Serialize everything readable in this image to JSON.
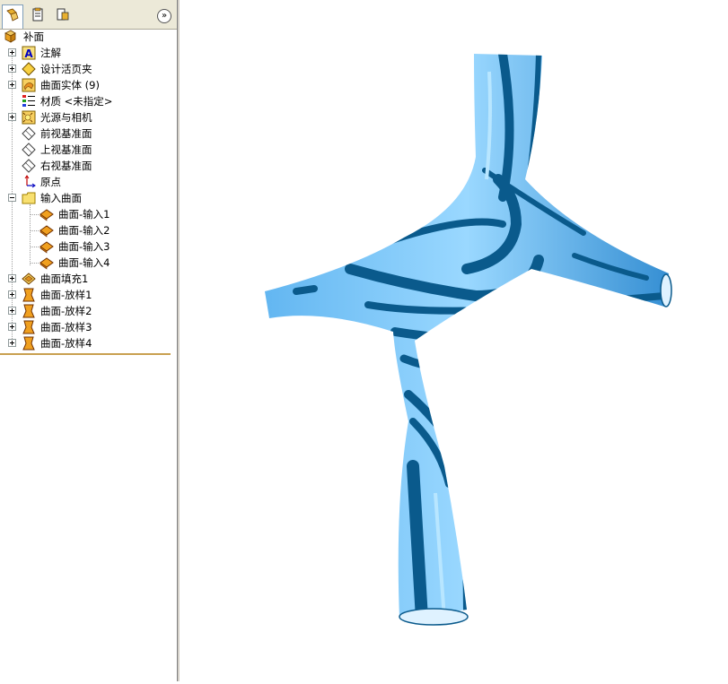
{
  "tree": {
    "root": "补面",
    "items": [
      {
        "label": "注解",
        "icon": "annotation-icon",
        "expander": "closed"
      },
      {
        "label": "设计活页夹",
        "icon": "design-binder-icon",
        "expander": "closed"
      },
      {
        "label": "曲面实体 (9)",
        "icon": "surface-bodies-icon",
        "expander": "closed"
      },
      {
        "label": "材质 <未指定>",
        "icon": "material-icon",
        "expander": "none"
      },
      {
        "label": "光源与相机",
        "icon": "lights-cameras-icon",
        "expander": "closed"
      },
      {
        "label": "前视基准面",
        "icon": "plane-icon",
        "expander": "none"
      },
      {
        "label": "上视基准面",
        "icon": "plane-icon",
        "expander": "none"
      },
      {
        "label": "右视基准面",
        "icon": "plane-icon",
        "expander": "none"
      },
      {
        "label": "原点",
        "icon": "origin-icon",
        "expander": "none"
      },
      {
        "label": "输入曲面",
        "icon": "folder-icon",
        "expander": "open"
      },
      {
        "label": "曲面-输入1",
        "icon": "imported-surface-icon",
        "expander": "child"
      },
      {
        "label": "曲面-输入2",
        "icon": "imported-surface-icon",
        "expander": "child"
      },
      {
        "label": "曲面-输入3",
        "icon": "imported-surface-icon",
        "expander": "child"
      },
      {
        "label": "曲面-输入4",
        "icon": "imported-surface-icon",
        "expander": "child"
      },
      {
        "label": "曲面填充1",
        "icon": "filled-surface-icon",
        "expander": "closed"
      },
      {
        "label": "曲面-放样1",
        "icon": "loft-surface-icon",
        "expander": "closed"
      },
      {
        "label": "曲面-放样2",
        "icon": "loft-surface-icon",
        "expander": "closed"
      },
      {
        "label": "曲面-放样3",
        "icon": "loft-surface-icon",
        "expander": "closed"
      },
      {
        "label": "曲面-放样4",
        "icon": "loft-surface-icon",
        "expander": "closed"
      }
    ]
  },
  "tabs": [
    "feature-manager-tab",
    "property-manager-tab",
    "configuration-manager-tab"
  ],
  "expand_glyph": "»",
  "colors": {
    "surface_light": "#7ec8f8",
    "surface_dark": "#0a5a8c",
    "panel_border": "#c8a050"
  }
}
